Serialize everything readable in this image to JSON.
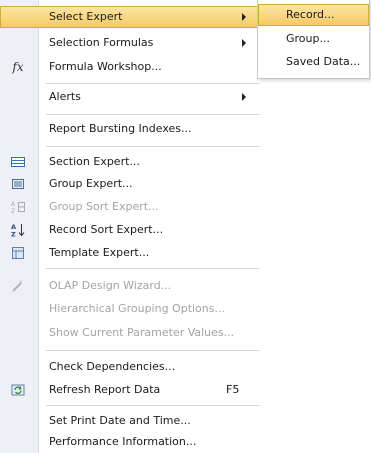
{
  "menu": {
    "select_expert": "Select Expert",
    "selection_formulas": "Selection Formulas",
    "formula_workshop": "Formula Workshop...",
    "alerts": "Alerts",
    "report_bursting": "Report Bursting Indexes...",
    "section_expert": "Section Expert...",
    "group_expert": "Group Expert...",
    "group_sort_expert": "Group Sort Expert...",
    "record_sort_expert": "Record Sort Expert...",
    "template_expert": "Template Expert...",
    "olap_design_wizard": "OLAP Design Wizard...",
    "hierarchical_grouping": "Hierarchical Grouping Options...",
    "show_param_values": "Show Current Parameter Values...",
    "check_dependencies": "Check Dependencies...",
    "refresh_report_data": "Refresh Report Data",
    "refresh_shortcut": "F5",
    "set_print_date": "Set Print Date and Time...",
    "performance_info": "Performance Information..."
  },
  "submenu": {
    "record": "Record...",
    "group": "Group...",
    "saved_data": "Saved Data..."
  },
  "icons": {
    "formula_glyph": "fx"
  }
}
